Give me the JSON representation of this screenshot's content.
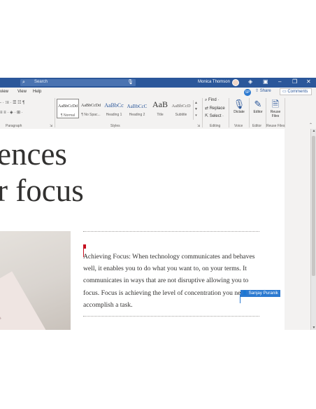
{
  "titlebar": {
    "search_placeholder": "Search",
    "user_name": "Monica Thomson",
    "window_icons": [
      "diamond-icon",
      "layout-icon",
      "minimize-icon",
      "restore-icon",
      "close-icon"
    ]
  },
  "menu": {
    "tabs": [
      "view",
      "View",
      "Help"
    ],
    "comment_avatar": "SP",
    "share_label": "Share",
    "comments_label": "Comments"
  },
  "ribbon": {
    "paragraph_label": "Paragraph",
    "styles_label": "Styles",
    "styles": [
      {
        "preview": "AaBbCcDd",
        "name": "¶ Normal"
      },
      {
        "preview": "AaBbCcDd",
        "name": "¶ No Spac..."
      },
      {
        "preview": "AaBbCc",
        "name": "Heading 1"
      },
      {
        "preview": "AaBbCcC",
        "name": "Heading 2"
      },
      {
        "preview": "AaB",
        "name": "Title"
      },
      {
        "preview": "AaBbCcD",
        "name": "Subtitle"
      }
    ],
    "editing": {
      "find": "Find",
      "replace": "Replace",
      "select": "Select",
      "label": "Editing"
    },
    "voice": {
      "button": "Dictate",
      "label": "Voice"
    },
    "editor": {
      "button": "Editor",
      "label": "Editor"
    },
    "reuse": {
      "button_line1": "Reuse",
      "button_line2": "Files",
      "label": "Reuse Files"
    }
  },
  "document": {
    "title_line1": "ences",
    "title_line2": "r focus",
    "body": "Achieving Focus: When technology communicates and behaves well, it enables you to do what you want to, on your terms. It communicates in ways that are not disruptive allowing you to focus. Focus is achieving the level of concentration you need to accomplish a task.",
    "collaborator": "Sanjay Puranik"
  },
  "colors": {
    "titlebar": "#2b579a",
    "cursor_owner": "#c50f1f",
    "collaborator": "#2b79d0"
  }
}
